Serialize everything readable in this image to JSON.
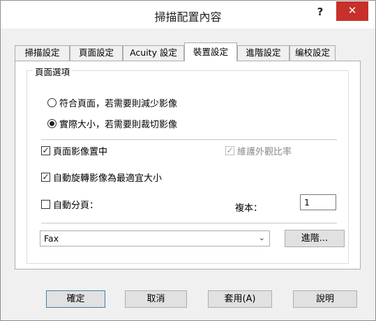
{
  "window": {
    "title": "掃描配置內容",
    "help_label": "?",
    "close_label": "✕"
  },
  "tabs": [
    {
      "label": "掃描設定"
    },
    {
      "label": "頁面設定"
    },
    {
      "label": "Acuity 設定"
    },
    {
      "label": "裝置設定"
    },
    {
      "label": "進階設定"
    },
    {
      "label": "编校設定"
    }
  ],
  "active_tab": "裝置設定",
  "page_options": {
    "group_label": "頁面選項",
    "radio_fit": {
      "label": "符合頁面，若需要則減少影像",
      "selected": false
    },
    "radio_actual": {
      "label": "實際大小，若需要則裁切影像",
      "selected": true
    },
    "center_image": {
      "label": "頁面影像置中",
      "checked": true
    },
    "keep_aspect": {
      "label": "維護外觀比率",
      "checked": true,
      "enabled": false
    },
    "auto_rotate": {
      "label": "自動旋轉影像為最適宜大小",
      "checked": true
    },
    "auto_page": {
      "label": "自動分頁：",
      "checked": false
    },
    "copies_label": "複本：",
    "copies_value": "1",
    "device_select": {
      "value": "Fax",
      "arrow": "⌄"
    },
    "advanced_button": "進階..."
  },
  "footer": {
    "ok": "確定",
    "cancel": "取消",
    "apply": "套用(A)",
    "help": "說明"
  }
}
